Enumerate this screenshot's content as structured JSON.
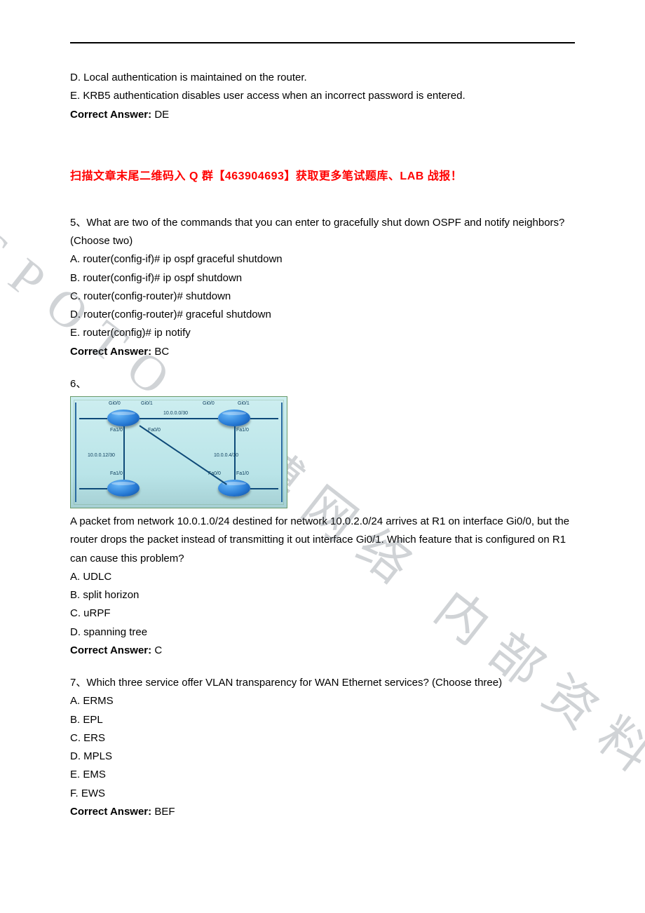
{
  "watermark": "SPOTO 思博网络 内部资料",
  "intro": {
    "optD": "D. Local authentication is maintained on the router.",
    "optE": "E. KRB5 authentication disables user access when an incorrect password is entered.",
    "answerLabel": "Correct Answer: ",
    "answerValue": "DE"
  },
  "banner": "扫描文章末尾二维码入 Q 群【463904693】获取更多笔试题库、LAB 战报！",
  "q5": {
    "stem": "5、What are two of the commands that you can enter to gracefully shut down OSPF and notify neighbors?(Choose two)",
    "optA": "A. router(config-if)# ip ospf graceful shutdown",
    "optB": "B. router(config-if)# ip ospf shutdown",
    "optC": "C. router(config-router)# shutdown",
    "optD": "D. router(config-router)# graceful shutdown",
    "optE": "E. router(config)# ip notify",
    "answerLabel": "Correct Answer: ",
    "answerValue": "BC"
  },
  "q6": {
    "number": "6、",
    "diagram": {
      "labels": {
        "topLeftNet": "10.0.0.0/30",
        "leftNet": "10.0.0.12/30",
        "rightNet": "10.0.0.4/30",
        "gi00": "Gi0/0",
        "gi01": "Gi0/1",
        "fa10": "Fa1/0",
        "fa00": "Fa0/0"
      }
    },
    "stem1": "A packet from network 10.0.1.0/24 destined for network 10.0.2.0/24 arrives at R1 on interface Gi0/0, but the",
    "stem2": "router drops the packet instead of transmitting it out interface Gi0/1. Which feature that is configured on R1",
    "stem3": "can cause this problem?",
    "optA": "A. UDLC",
    "optB": "B. split horizon",
    "optC": "C. uRPF",
    "optD": "D. spanning tree",
    "answerLabel": "Correct Answer: ",
    "answerValue": "C"
  },
  "q7": {
    "stem": "7、Which three service offer VLAN transparency for WAN Ethernet services? (Choose three)",
    "optA": "A. ERMS",
    "optB": "B. EPL",
    "optC": "C. ERS",
    "optD": "D. MPLS",
    "optE": "E. EMS",
    "optF": "F. EWS",
    "answerLabel": "Correct Answer: ",
    "answerValue": "BEF"
  }
}
